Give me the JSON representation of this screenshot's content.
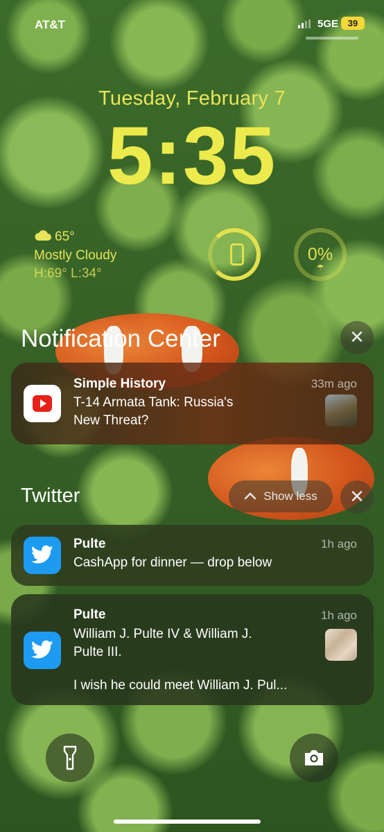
{
  "status_bar": {
    "carrier": "AT&T",
    "network": "5GE",
    "battery": "39"
  },
  "lock_screen": {
    "date": "Tuesday, February 7",
    "time": "5:35"
  },
  "widgets": {
    "weather": {
      "temperature": "65°",
      "condition": "Mostly Cloudy",
      "high_low": "H:69° L:34°",
      "icon": "cloud-icon"
    },
    "phone_battery": {
      "icon": "iphone-icon"
    },
    "rain_chance": {
      "value": "0%",
      "icon": "umbrella-icon"
    }
  },
  "notification_center": {
    "title": "Notification Center",
    "clear_icon": "close-icon",
    "notifications": [
      {
        "app": "YouTube",
        "title": "Simple History",
        "time": "33m ago",
        "body_line1": "T-14 Armata Tank: Russia's",
        "body_line2": "New Threat?"
      }
    ]
  },
  "twitter_group": {
    "title": "Twitter",
    "show_less": "Show less",
    "notifications": [
      {
        "title": "Pulte",
        "time": "1h ago",
        "body": "CashApp for dinner — drop below"
      },
      {
        "title": "Pulte",
        "time": "1h ago",
        "body_line1": "William J. Pulte IV & William J.",
        "body_line2": "Pulte III.",
        "body_line3": "I wish he could meet William J. Pul..."
      }
    ]
  },
  "quick_actions": {
    "left": "flashlight-icon",
    "right": "camera-icon"
  },
  "colors": {
    "clock": "#ecea4c",
    "youtube_red": "#e62117",
    "twitter_blue": "#1d9bf0",
    "battery_yellow": "#f6d83a"
  }
}
